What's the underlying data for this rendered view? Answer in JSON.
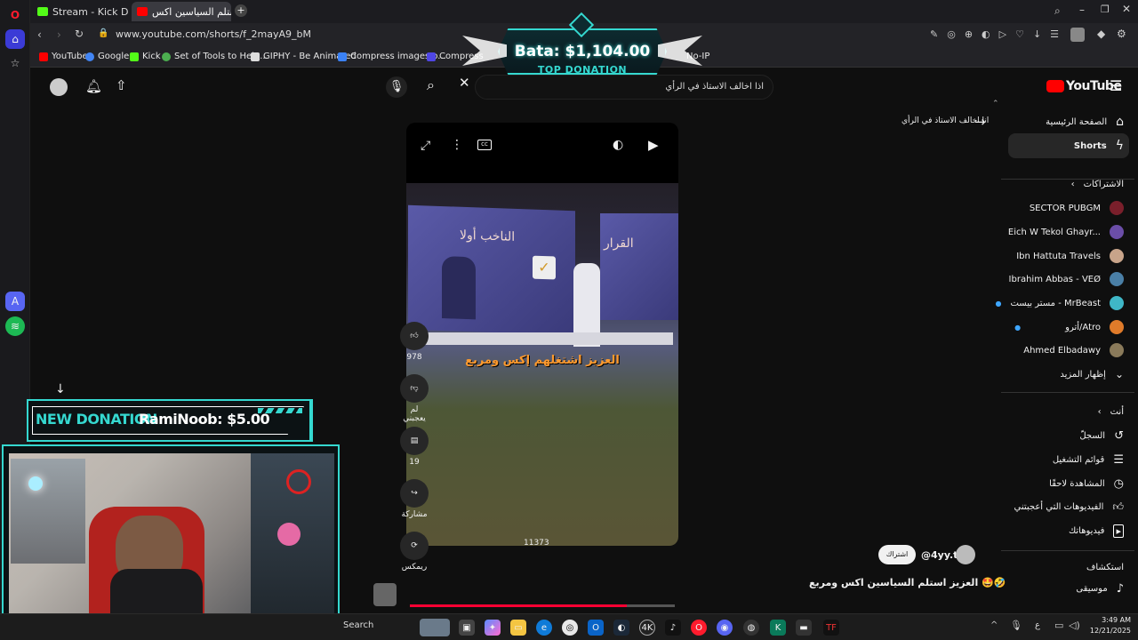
{
  "browser": {
    "tabs": [
      {
        "label": "Stream - Kick Dashboard",
        "active": false
      },
      {
        "label": "العزيز استلم السياسين اكس",
        "active": true
      }
    ],
    "url": "www.youtube.com/shorts/f_2mayA9_bM",
    "bookmarks": [
      "YouTube",
      "Google",
      "Kick",
      "Set of Tools to Help...",
      "GIPHY - Be Animated",
      "Compress images o...",
      "Compress",
      "No-IP"
    ]
  },
  "overlay": {
    "top_donation_amount": "Bata: $1,104.00",
    "top_donation_label": "TOP DONATION",
    "new_donation_label": "NEW DONATION",
    "new_donation_user": "RamiNoob: $5.00"
  },
  "youtube": {
    "logo": "YouTube",
    "search_query": "اذا اخالف الاستاذ في الرأي",
    "back_title": "انا اخالف الاستاذ في الرأي",
    "nav_home": "الصفحة الرئيسية",
    "nav_shorts": "Shorts",
    "subscriptions_title": "الاشتراكات",
    "subscriptions": [
      "SECTOR PUBGM",
      "Eich W Tekol Ghayr...",
      "Ibn Hattuta Travels",
      "Ibrahim Abbas - VEØ",
      "مستر بيست - MrBeast",
      "أترو/Atro",
      "Ahmed Elbadawy"
    ],
    "show_more": "إظهار المزيد",
    "you_title": "أنت",
    "you_items": [
      "السجلّ",
      "قوائم التشغيل",
      "المشاهدة لاحقًا",
      "الفيديوهات التي أعجبتني",
      "فيديوهاتك"
    ],
    "explore_title": "استكشاف",
    "explore_items": [
      "موسيقى"
    ],
    "video_caption": "العزيز اشتغلهم إكس ومربع",
    "video_sign_left": "الناخب أولا",
    "video_sign_right": "القرار",
    "video_counter": "11373",
    "likes": "978",
    "dislike_label": "لم يعجبني",
    "comments": "19",
    "share_label": "مشاركة",
    "remix_label": "ريمكس",
    "channel_handle": "@4yy.t",
    "subscribe_label": "اشتراك",
    "short_title": "العزيز استلم السياسين اكس ومربع 🤩🤣"
  },
  "taskbar": {
    "search": "Search",
    "lang": "ع",
    "time": "3:49 AM",
    "date": "12/21/2025"
  },
  "colors": {
    "accent": "#35d8d0",
    "yt_red": "#ff0000",
    "progress": "#ff0033"
  }
}
